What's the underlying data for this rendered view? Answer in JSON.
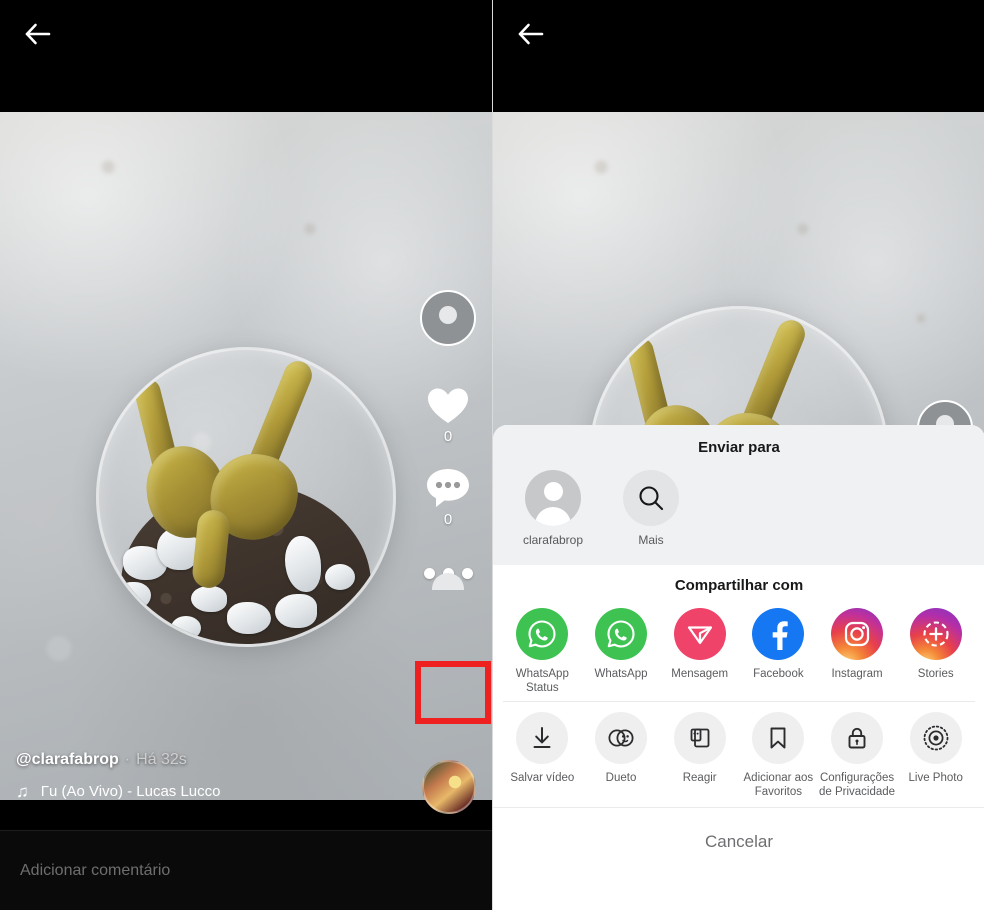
{
  "app": "TikTok",
  "left_panel": {
    "back_icon": "back-arrow-icon",
    "video_alt": "cactus-in-glass-bowl",
    "rail": {
      "avatar_icon": "profile-avatar-icon",
      "like_icon": "heart-icon",
      "like_count": "0",
      "comment_icon": "comment-bubble-icon",
      "comment_count": "0",
      "more_icon": "three-dots-icon"
    },
    "username": "@clarafabrop",
    "separator": "·",
    "timestamp": "Há 32s",
    "music_note_icon": "music-note-icon",
    "music_label": "Γu (Ao Vivo) - Lucas Lucco",
    "music_avatar_icon": "music-disc-avatar",
    "comment_placeholder": "Adicionar comentário"
  },
  "right_panel": {
    "back_icon": "back-arrow-icon",
    "share_sheet": {
      "send_to_title": "Enviar para",
      "send_to_items": [
        {
          "label": "clarafabrop",
          "icon": "profile-avatar-icon"
        },
        {
          "label": "Mais",
          "icon": "search-icon"
        }
      ],
      "share_with_title": "Compartilhar com",
      "share_with_items": [
        {
          "label": "WhatsApp\nStatus",
          "label_line1": "WhatsApp",
          "label_line2": "Status",
          "icon": "whatsapp-icon",
          "color": "#3ec352"
        },
        {
          "label": "WhatsApp",
          "label_line1": "WhatsApp",
          "label_line2": "",
          "icon": "whatsapp-icon",
          "color": "#3ec352"
        },
        {
          "label": "Mensagem",
          "label_line1": "Mensagem",
          "label_line2": "",
          "icon": "direct-message-icon",
          "color": "#f0436a"
        },
        {
          "label": "Facebook",
          "label_line1": "Facebook",
          "label_line2": "",
          "icon": "facebook-icon",
          "color": "#1577f2"
        },
        {
          "label": "Instagram",
          "label_line1": "Instagram",
          "label_line2": "",
          "icon": "instagram-icon",
          "color": "#c1309a"
        },
        {
          "label": "Stories",
          "label_line1": "Stories",
          "label_line2": "",
          "icon": "instagram-stories-icon",
          "color": "#b42ea8"
        }
      ],
      "action_items": [
        {
          "label_line1": "Salvar vídeo",
          "label_line2": "",
          "icon": "download-icon"
        },
        {
          "label_line1": "Dueto",
          "label_line2": "",
          "icon": "duet-icon"
        },
        {
          "label_line1": "Reagir",
          "label_line2": "",
          "icon": "react-icon"
        },
        {
          "label_line1": "Adicionar aos",
          "label_line2": "Favoritos",
          "icon": "bookmark-icon"
        },
        {
          "label_line1": "Configurações",
          "label_line2": "de Privacidade",
          "icon": "lock-icon"
        },
        {
          "label_line1": "Live Photo",
          "label_line2": "",
          "icon": "live-photo-icon"
        }
      ],
      "cancel_label": "Cancelar"
    }
  },
  "annotations": {
    "highlight_color": "#ee2020",
    "boxes": [
      {
        "target": "three-dots-icon",
        "panel": "left"
      },
      {
        "target": "salvar-video-action",
        "panel": "right"
      }
    ]
  }
}
